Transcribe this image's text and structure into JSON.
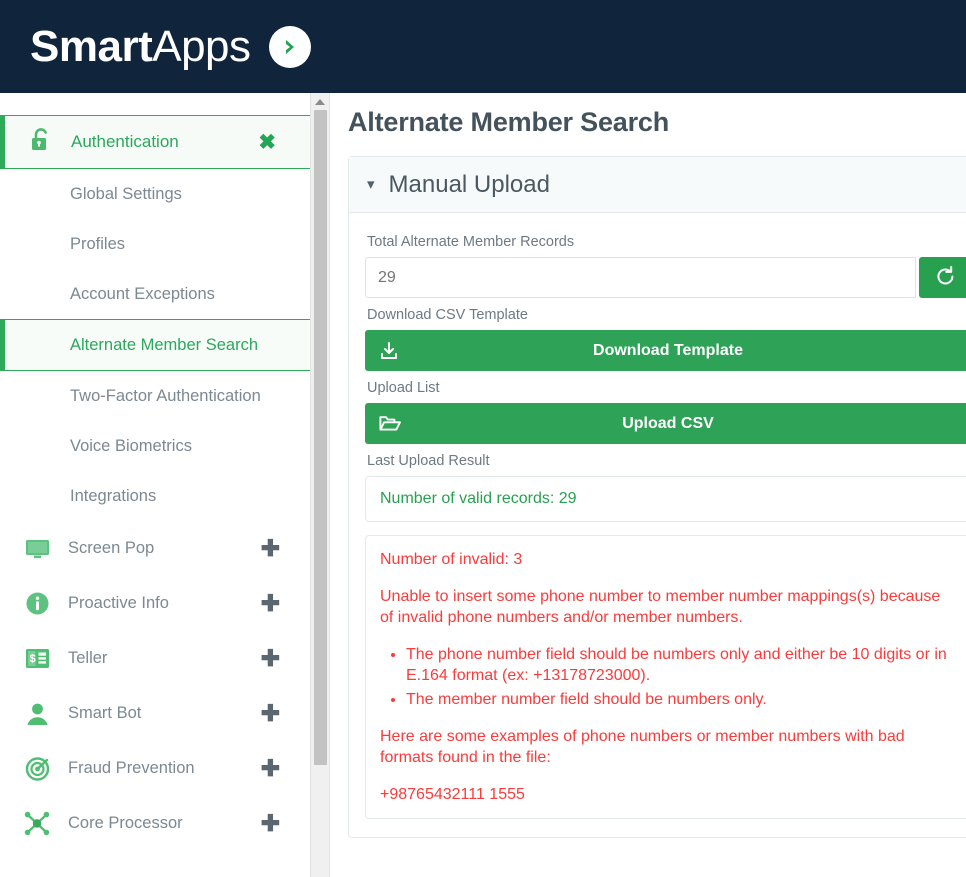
{
  "header": {
    "logo_bold": "Smart",
    "logo_light": "Apps",
    "logo_mark_icon": "chevron-right-icon"
  },
  "sidebar": {
    "group": {
      "label": "Authentication",
      "icon": "unlock-icon",
      "close_label": "✖"
    },
    "sub_items": [
      {
        "label": "Global Settings",
        "active": false
      },
      {
        "label": "Profiles",
        "active": false
      },
      {
        "label": "Account Exceptions",
        "active": false
      },
      {
        "label": "Alternate Member Search",
        "active": true
      },
      {
        "label": "Two-Factor Authentication",
        "active": false
      },
      {
        "label": "Voice Biometrics",
        "active": false
      },
      {
        "label": "Integrations",
        "active": false
      }
    ],
    "apps": [
      {
        "label": "Screen Pop",
        "icon": "monitor-icon",
        "add_label": "✚"
      },
      {
        "label": "Proactive Info",
        "icon": "info-circle-icon",
        "add_label": "✚"
      },
      {
        "label": "Teller",
        "icon": "money-icon",
        "add_label": "✚"
      },
      {
        "label": "Smart Bot",
        "icon": "person-icon",
        "add_label": "✚"
      },
      {
        "label": "Fraud Prevention",
        "icon": "radar-icon",
        "add_label": "✚"
      },
      {
        "label": "Core Processor",
        "icon": "network-icon",
        "add_label": "✚"
      }
    ]
  },
  "main": {
    "page_title": "Alternate Member Search",
    "panel_title": "Manual Upload",
    "panel_chevron_icon": "chevron-down-icon",
    "total_records": {
      "label": "Total Alternate Member Records",
      "value": "29",
      "placeholder": "29",
      "refresh_icon": "refresh-icon"
    },
    "download": {
      "label": "Download CSV Template",
      "button_label": "Download Template",
      "icon": "download-icon"
    },
    "upload": {
      "label": "Upload List",
      "button_label": "Upload CSV",
      "icon": "open-folder-icon"
    },
    "last_result": {
      "label": "Last Upload Result",
      "valid_text": "Number of valid records: 29",
      "invalid_count_text": "Number of invalid: 3",
      "intro_text": "Unable to insert some phone number to member number mappings(s) because of invalid phone numbers and/or member numbers.",
      "bullets": [
        "The phone number field should be numbers only and either be 10 digits or in E.164 format (ex: +13178723000).",
        "The member number field should be numbers only."
      ],
      "examples_intro": "Here are some examples of phone numbers or member numbers with bad formats found in the file:",
      "example_line": "+98765432111 1555"
    }
  },
  "colors": {
    "header_bg": "#10253c",
    "brand_green": "#2ea357",
    "error_red": "#fa3b3b",
    "muted_text": "#7c8892"
  }
}
